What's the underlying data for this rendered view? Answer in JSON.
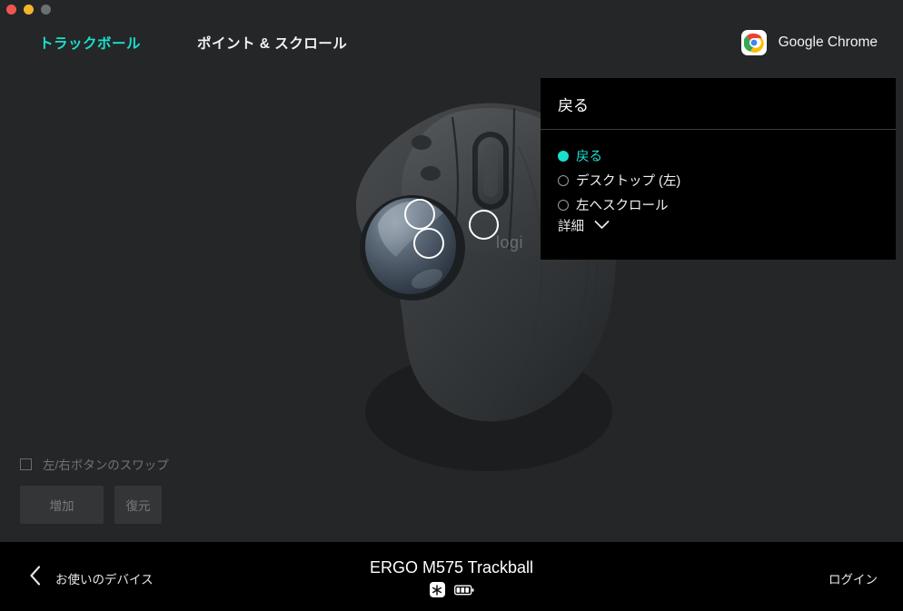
{
  "window": {
    "traffic_lights": [
      {
        "name": "close",
        "color": "#f05650"
      },
      {
        "name": "minimize",
        "color": "#f4b52c"
      },
      {
        "name": "maximize",
        "color": "#6e6f71"
      }
    ]
  },
  "tabs": [
    {
      "label": "トラックボール",
      "active": true
    },
    {
      "label": "ポイント & スクロール",
      "active": false
    }
  ],
  "app_context": {
    "icon": "chrome-icon",
    "name": "Google Chrome"
  },
  "device_illustration": {
    "brand_mark": "logi",
    "callouts": [
      {
        "name": "callout-button-top-left"
      },
      {
        "name": "callout-button-bottom-left"
      },
      {
        "name": "callout-button-right"
      }
    ]
  },
  "controls": {
    "swap_checkbox": {
      "label": "左/右ボタンのスワップ",
      "checked": false,
      "disabled": true
    },
    "buttons": [
      {
        "name": "add-button",
        "label": "増加",
        "disabled": true
      },
      {
        "name": "restore-button",
        "label": "復元",
        "disabled": true
      }
    ]
  },
  "popup": {
    "title": "戻る",
    "options": [
      {
        "label": "戻る",
        "selected": true
      },
      {
        "label": "デスクトップ (左)",
        "selected": false
      },
      {
        "label": "左へスクロール",
        "selected": false
      }
    ],
    "more_label": "詳細",
    "more_icon": "chevron-down-icon"
  },
  "footer": {
    "back_icon": "chevron-left-icon",
    "back_label": "お使いのデバイス",
    "device_name": "ERGO M575 Trackball",
    "badges": [
      {
        "name": "bluetooth-icon"
      },
      {
        "name": "battery-icon",
        "level": 3
      }
    ],
    "login_label": "ログイン"
  },
  "colors": {
    "accent": "#19e0cd",
    "background": "#252628",
    "popup_background": "#000000",
    "footer_background": "#000000",
    "text_primary": "#f2f2f2",
    "text_disabled": "#727375"
  }
}
